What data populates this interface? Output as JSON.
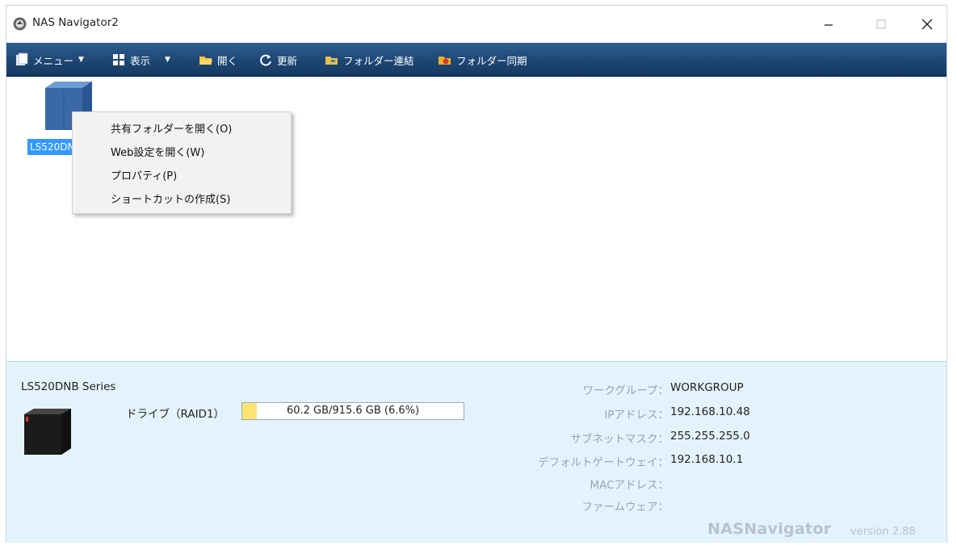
{
  "window": {
    "title": "NAS Navigator2"
  },
  "icons": {
    "app": "app-logo-icon",
    "minimize": "minimize-icon",
    "maximize": "maximize-icon",
    "close": "close-icon",
    "menu": "menu-icon",
    "view": "view-icon",
    "open": "folder-open-icon",
    "refresh": "refresh-icon",
    "folder_connect": "folder-connect-icon",
    "folder_sync": "folder-sync-icon",
    "nas": "nas-device-icon"
  },
  "toolbar": {
    "menu_label": "メニュー",
    "view_label": "表示",
    "open_label": "開く",
    "refresh_label": "更新",
    "folder_connect_label": "フォルダー連結",
    "folder_sync_label": "フォルダー同期"
  },
  "device": {
    "label": "LS520DNB Series"
  },
  "context_menu": {
    "items": [
      "共有フォルダーを開く(O)",
      "Web設定を開く(W)",
      "プロパティ(P)",
      "ショートカットの作成(S)"
    ]
  },
  "info": {
    "series_name": "LS520DNB Series",
    "drive_label": "ドライブ（RAID1）",
    "drive_usage_text": "60.2 GB/915.6 GB (6.6%)",
    "drive_usage_percent": 6.6,
    "rows": [
      {
        "key": "ワークグループ：",
        "value": "WORKGROUP"
      },
      {
        "key": "IPアドレス：",
        "value": "192.168.10.48"
      },
      {
        "key": "サブネットマスク：",
        "value": "255.255.255.0"
      },
      {
        "key": "デフォルトゲートウェイ：",
        "value": "192.168.10.1"
      },
      {
        "key": "MACアドレス：",
        "value": ""
      },
      {
        "key": "ファームウェア：",
        "value": ""
      }
    ]
  },
  "branding": {
    "name": "NASNavigator",
    "version": "version 2.88"
  },
  "colors": {
    "toolbar_bg": "#1f4775",
    "info_bg": "#e4f3fb",
    "selection": "#3399ff",
    "drive_fill": "#ffe373"
  }
}
